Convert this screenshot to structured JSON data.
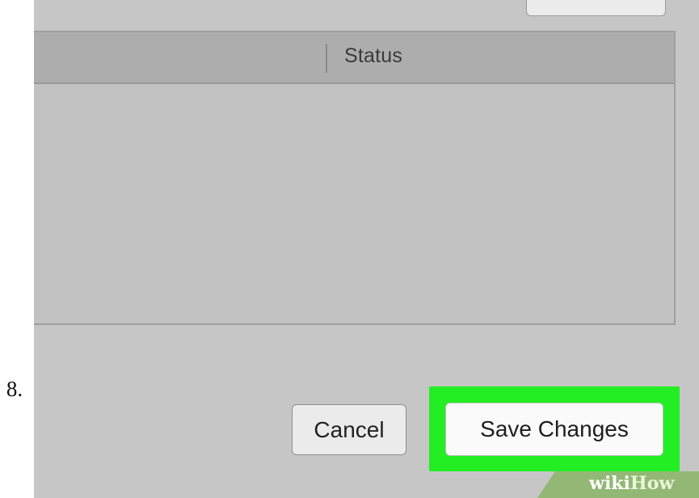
{
  "step": {
    "number": "8."
  },
  "table": {
    "columns": [
      "",
      "Status"
    ],
    "rows": []
  },
  "buttons": {
    "cancel": "Cancel",
    "save": "Save Changes"
  },
  "highlight": {
    "color": "#23ee23",
    "target": "save-changes-button"
  },
  "watermark": {
    "part1": "wiki",
    "part2": "How"
  }
}
